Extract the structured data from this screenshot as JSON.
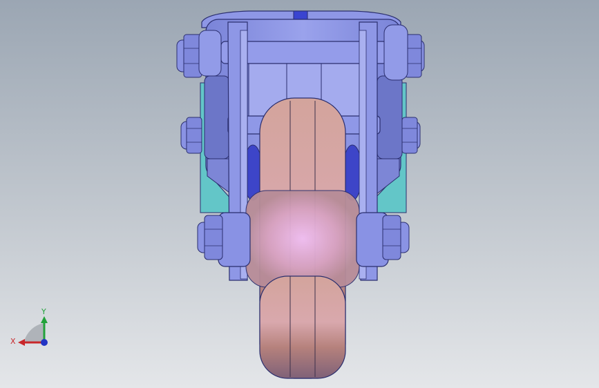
{
  "viewport": {
    "background_top": "#9ba6b3",
    "background_bottom": "#e4e6e9"
  },
  "model": {
    "part_type": "swivel caster wheel",
    "colors": {
      "frame": "#8e97e6",
      "frame_dark": "#6c76c8",
      "frame_light": "#b3b9f2",
      "edge": "#2a2e6e",
      "wheel_light": "#e5b2ba",
      "wheel_mid": "#c48d88",
      "wheel_dark": "#7d5f7a",
      "hub_highlight": "#e9b4ee",
      "accent_cyan": "#63c6c8"
    }
  },
  "triad": {
    "x_label": "X",
    "y_label": "Y",
    "x_color": "#c8262a",
    "y_color": "#22a23a",
    "z_color": "#2234c4"
  }
}
